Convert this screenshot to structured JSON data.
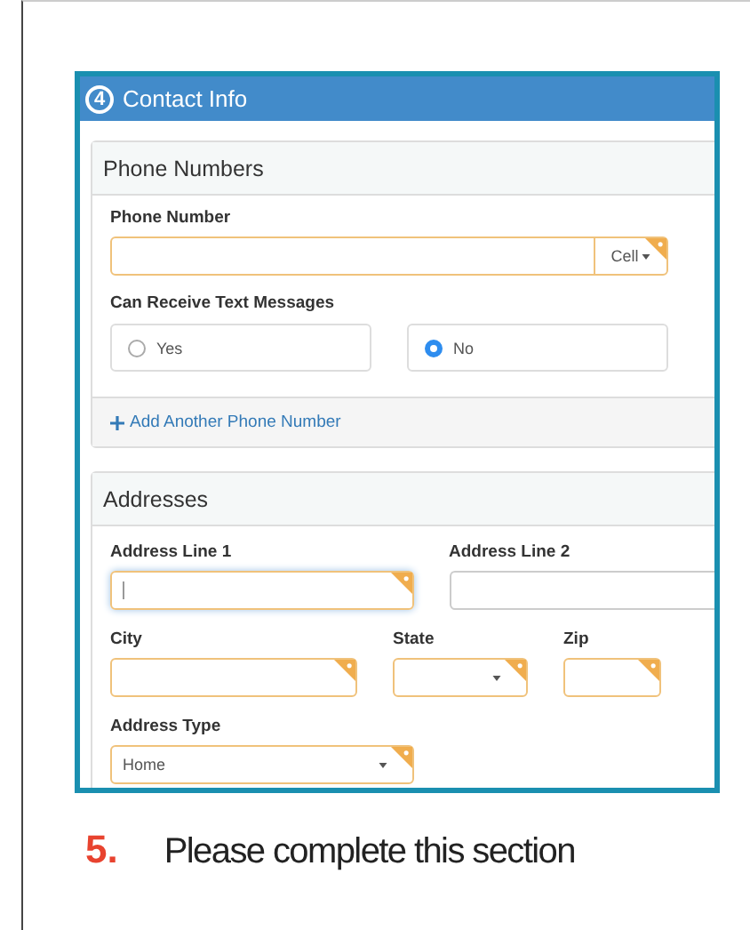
{
  "section": {
    "number": "4",
    "title": "Contact Info"
  },
  "phone_panel": {
    "title": "Phone Numbers",
    "phone_field": {
      "label": "Phone Number",
      "type_button": "Cell",
      "required": true
    },
    "text_messages": {
      "label": "Can Receive Text Messages",
      "options": [
        {
          "label": "Yes",
          "selected": false
        },
        {
          "label": "No",
          "selected": true
        }
      ]
    },
    "add_link": "Add Another Phone Number"
  },
  "address_panel": {
    "title": "Addresses",
    "rows": [
      [
        {
          "label": "Address Line 1",
          "kind": "text",
          "required": true,
          "focused": true
        },
        {
          "label": "Address Line 2",
          "kind": "text",
          "required": false,
          "focused": false
        }
      ],
      [
        {
          "label": "City",
          "kind": "text",
          "required": true,
          "focused": false
        },
        {
          "label": "State",
          "kind": "select",
          "required": true,
          "focused": false
        },
        {
          "label": "Zip",
          "kind": "text",
          "required": true,
          "focused": false
        }
      ],
      [
        {
          "label": "Address Type",
          "kind": "select",
          "value": "Home",
          "required": true,
          "focused": false
        }
      ]
    ]
  },
  "caption": {
    "number": "5.",
    "text": "Please complete this section"
  }
}
